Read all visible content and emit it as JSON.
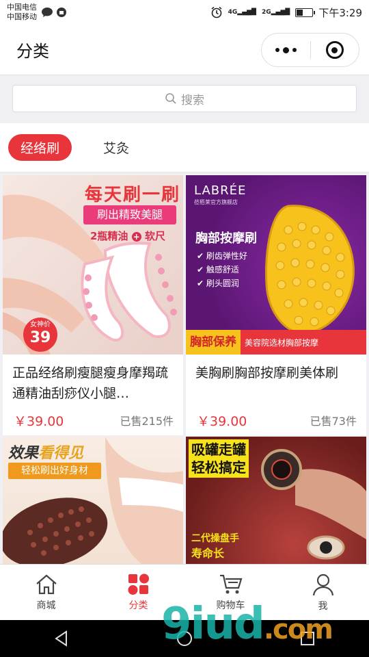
{
  "status_bar": {
    "carrier_1": "中国电信",
    "carrier_2": "中国移动",
    "net_1": "4G",
    "net_2": "2G",
    "time": "下午3:29",
    "battery_level": 0.4
  },
  "nav": {
    "title": "分类"
  },
  "search": {
    "placeholder": "搜索"
  },
  "tabs": [
    {
      "label": "经络刷",
      "active": true
    },
    {
      "label": "艾灸",
      "active": false
    }
  ],
  "products": [
    {
      "name": "正品经络刷瘦腿瘦身摩羯疏通精油刮痧仪小腿…",
      "price": "￥39.00",
      "sold": "已售215件",
      "banner": "每天刷一刷",
      "tagline": "刷出精致美腿",
      "promo": "2瓶精油",
      "promo_2": "软尺",
      "badge_label": "女神价",
      "badge_value": "39"
    },
    {
      "name": "美胸刷胸部按摩刷美体刷",
      "price": "￥39.00",
      "sold": "已售73件",
      "brand": "LABRÉE",
      "brand_sub": "莅栢莱官方旗舰店",
      "banner": "胸部按摩刷",
      "features": [
        "刷齿弹性好",
        "触感舒适",
        "刷头圆润"
      ],
      "footer_left": "胸部保养",
      "footer_right": "美容院选材胸部按摩"
    },
    {
      "banner_a": "效果",
      "banner_b": "看得见",
      "tagline": "轻松刷出好身材"
    },
    {
      "banner_1": "吸罐走罐",
      "banner_2": "轻松搞定",
      "footer_1": "二代操盘手",
      "footer_2": "寿命长"
    }
  ],
  "tabbar": [
    {
      "label": "商城",
      "icon": "home-icon",
      "active": false
    },
    {
      "label": "分类",
      "icon": "category-icon",
      "active": true
    },
    {
      "label": "购物车",
      "icon": "cart-icon",
      "active": false
    },
    {
      "label": "我",
      "icon": "user-icon",
      "active": false
    }
  ],
  "watermark": {
    "main": "9iud",
    "suffix": ".com"
  },
  "colors": {
    "accent": "#e8353b",
    "purple": "#6a1e86",
    "yellow": "#f7c21b"
  }
}
